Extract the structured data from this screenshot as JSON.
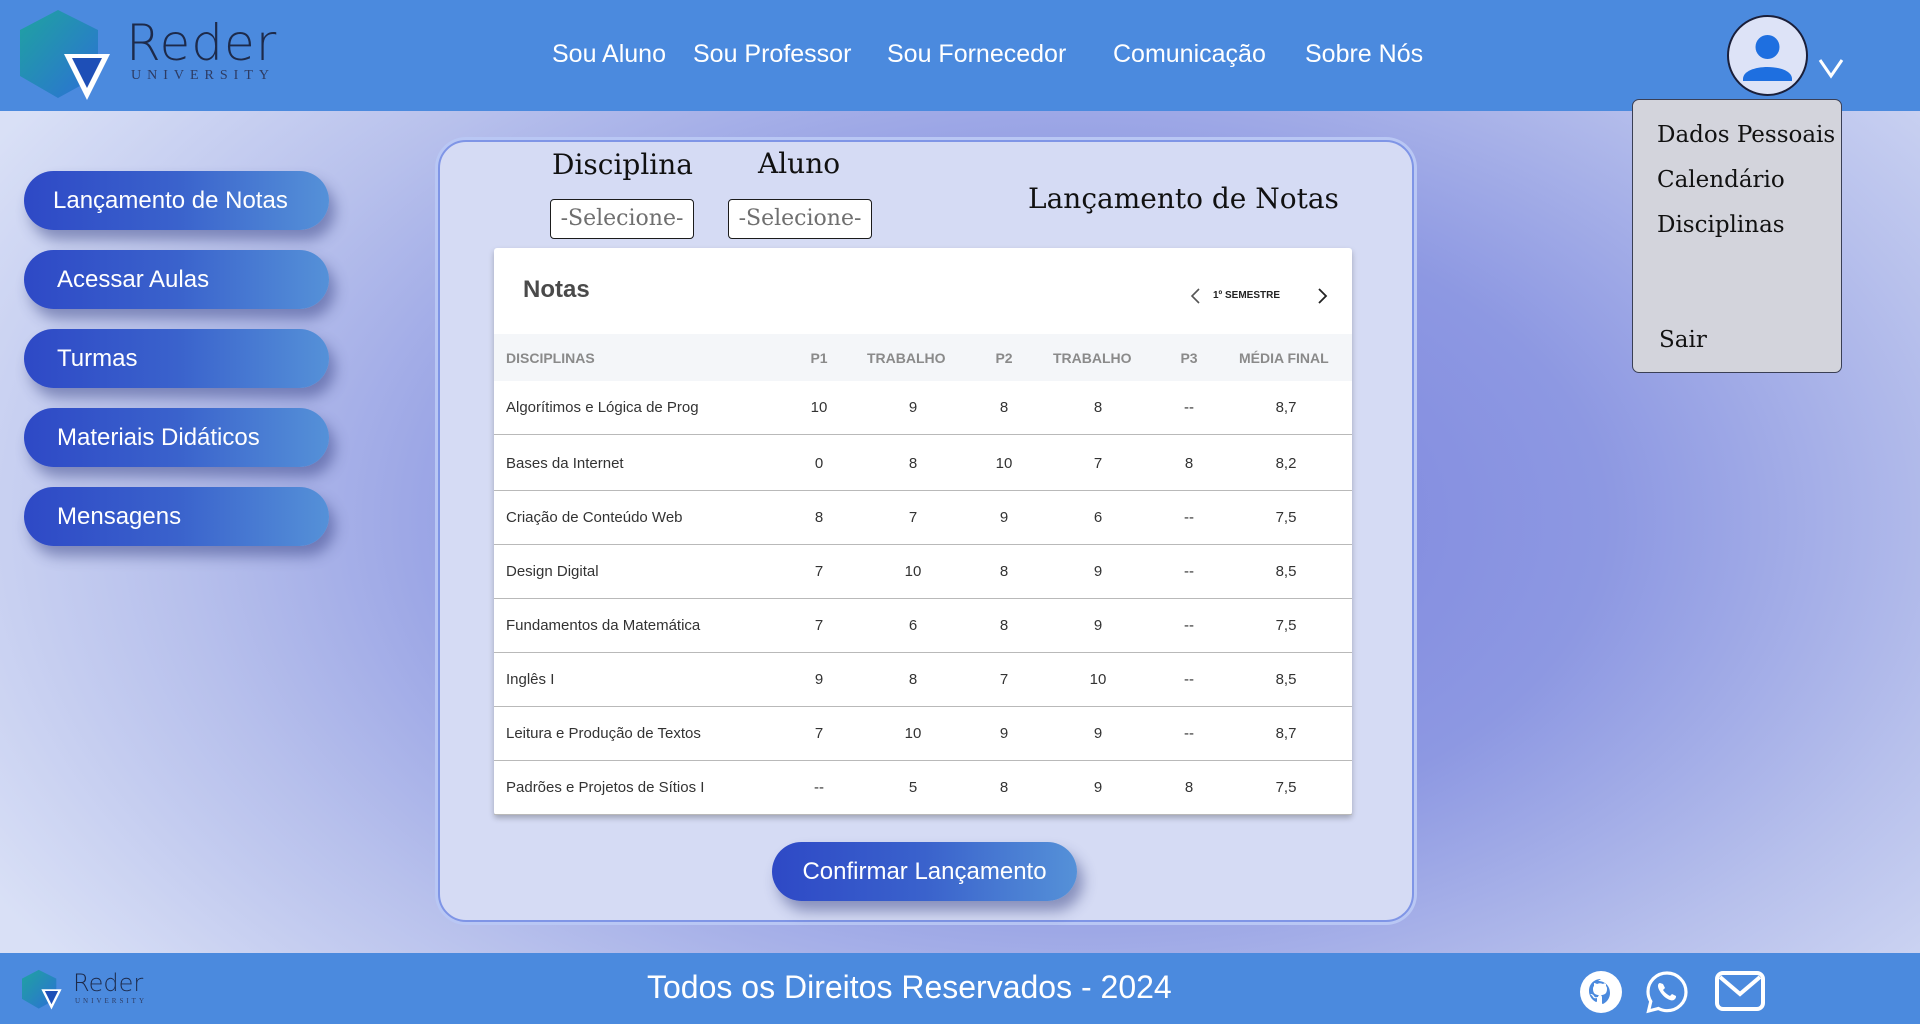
{
  "brand": {
    "name": "Reder",
    "subtitle": "UNIVERSITY"
  },
  "nav": {
    "items": [
      "Sou Aluno",
      "Sou Professor",
      "Sou Fornecedor",
      "Comunicação",
      "Sobre Nós"
    ]
  },
  "user_menu": {
    "items": [
      "Dados Pessoais",
      "Calendário",
      "Disciplinas"
    ],
    "logout": "Sair"
  },
  "sidebar": {
    "items": [
      "Lançamento de Notas",
      "Acessar Aulas",
      "Turmas",
      "Materiais Didáticos",
      "Mensagens"
    ],
    "active": "Lançamento de Notas"
  },
  "filters": {
    "discipline_label": "Disciplina",
    "discipline_value": "-Selecione-",
    "student_label": "Aluno",
    "student_value": "-Selecione-"
  },
  "page_title": "Lançamento de Notas",
  "grades": {
    "title": "Notas",
    "semester": "1º SEMESTRE",
    "columns": [
      "DISCIPLINAS",
      "P1",
      "TRABALHO",
      "P2",
      "TRABALHO",
      "P3",
      "MÉDIA FINAL"
    ],
    "rows": [
      [
        "Algorítimos e Lógica de Prog",
        "10",
        "9",
        "8",
        "8",
        "--",
        "8,7"
      ],
      [
        "Bases da Internet",
        "0",
        "8",
        "10",
        "7",
        "8",
        "8,2"
      ],
      [
        "Criação de Conteúdo Web",
        "8",
        "7",
        "9",
        "6",
        "--",
        "7,5"
      ],
      [
        "Design Digital",
        "7",
        "10",
        "8",
        "9",
        "--",
        "8,5"
      ],
      [
        "Fundamentos da Matemática",
        "7",
        "6",
        "8",
        "9",
        "--",
        "7,5"
      ],
      [
        "Inglês I",
        "9",
        "8",
        "7",
        "10",
        "--",
        "8,5"
      ],
      [
        "Leitura e Produção de Textos",
        "7",
        "10",
        "9",
        "9",
        "--",
        "8,7"
      ],
      [
        "Padrões e Projetos de Sítios I",
        "--",
        "5",
        "8",
        "9",
        "8",
        "7,5"
      ]
    ]
  },
  "confirm_label": "Confirmar Lançamento",
  "footer": {
    "copyright": "Todos os Direitos Reservados - 2024",
    "icons": [
      "github-icon",
      "whatsapp-icon",
      "mail-icon"
    ]
  },
  "colors": {
    "header": "#4b8ade",
    "button_start": "#2e49c6",
    "button_end": "#5591d8",
    "panel": "#d5dbf4"
  }
}
